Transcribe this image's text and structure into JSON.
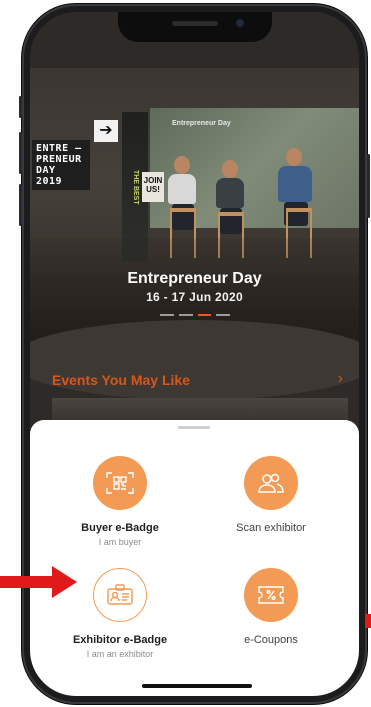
{
  "hero": {
    "banner_text": "ENTRE — PRENEUR DAY 2019",
    "screen_text": "Entrepreneur Day",
    "pillar_text": "THE BEST",
    "sign_text": "JOIN US!",
    "title": "Entrepreneur Day",
    "date": "16 - 17 Jun 2020",
    "slide_count": 4,
    "active_slide": 2
  },
  "section": {
    "title": "Events You May Like"
  },
  "options": [
    {
      "label": "Buyer e-Badge",
      "sub": "I am buyer",
      "icon": "qr-code-icon"
    },
    {
      "label": "Scan exhibitor",
      "sub": "",
      "icon": "people-icon"
    },
    {
      "label": "Exhibitor e-Badge",
      "sub": "I am an exhibitor",
      "icon": "id-card-icon"
    },
    {
      "label": "e-Coupons",
      "sub": "",
      "icon": "coupon-percent-icon"
    }
  ],
  "colors": {
    "accent": "#f39b54",
    "section_title": "#d6571c",
    "annotation_arrow": "#e01a1a"
  }
}
